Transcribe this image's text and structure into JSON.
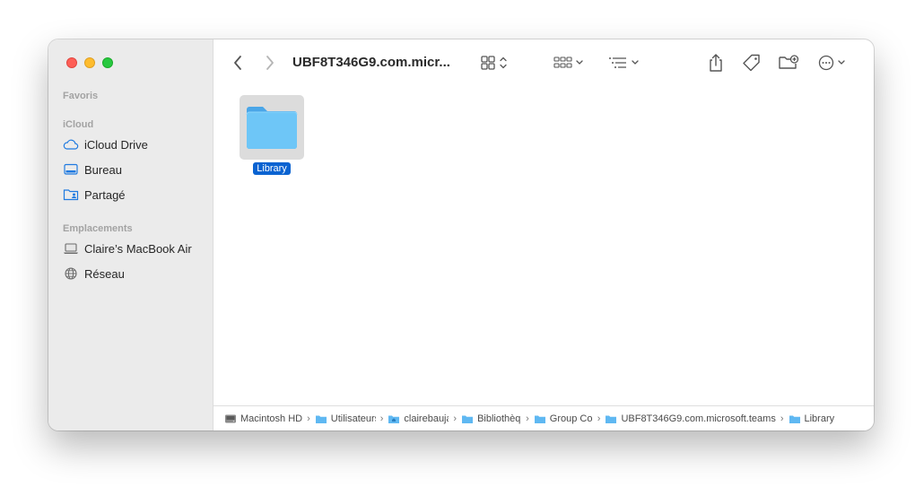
{
  "window": {
    "title": "UBF8T346G9.com.micr..."
  },
  "sidebar": {
    "favorites_title": "Favoris",
    "icloud_title": "iCloud",
    "icloud_items": [
      {
        "label": "iCloud Drive",
        "icon": "cloud-icon"
      },
      {
        "label": "Bureau",
        "icon": "desktop-icon"
      },
      {
        "label": "Partagé",
        "icon": "shared-folder-icon"
      }
    ],
    "locations_title": "Emplacements",
    "location_items": [
      {
        "label": "Claire’s MacBook Air",
        "icon": "laptop-icon"
      },
      {
        "label": "Réseau",
        "icon": "network-globe-icon"
      }
    ]
  },
  "files": [
    {
      "name": "Library",
      "selected": true,
      "icon": "folder-icon"
    }
  ],
  "pathbar": [
    "Macintosh HD",
    "Utilisateurs",
    "clairebaujard",
    "Bibliothèque",
    "Group Containers",
    "UBF8T346G9.com.microsoft.teams",
    "Library"
  ],
  "colors": {
    "accent": "#0a63d1",
    "folder": "#6ec6f7",
    "close": "#fe5f57",
    "minimize": "#febc2e",
    "zoom": "#28c840"
  }
}
